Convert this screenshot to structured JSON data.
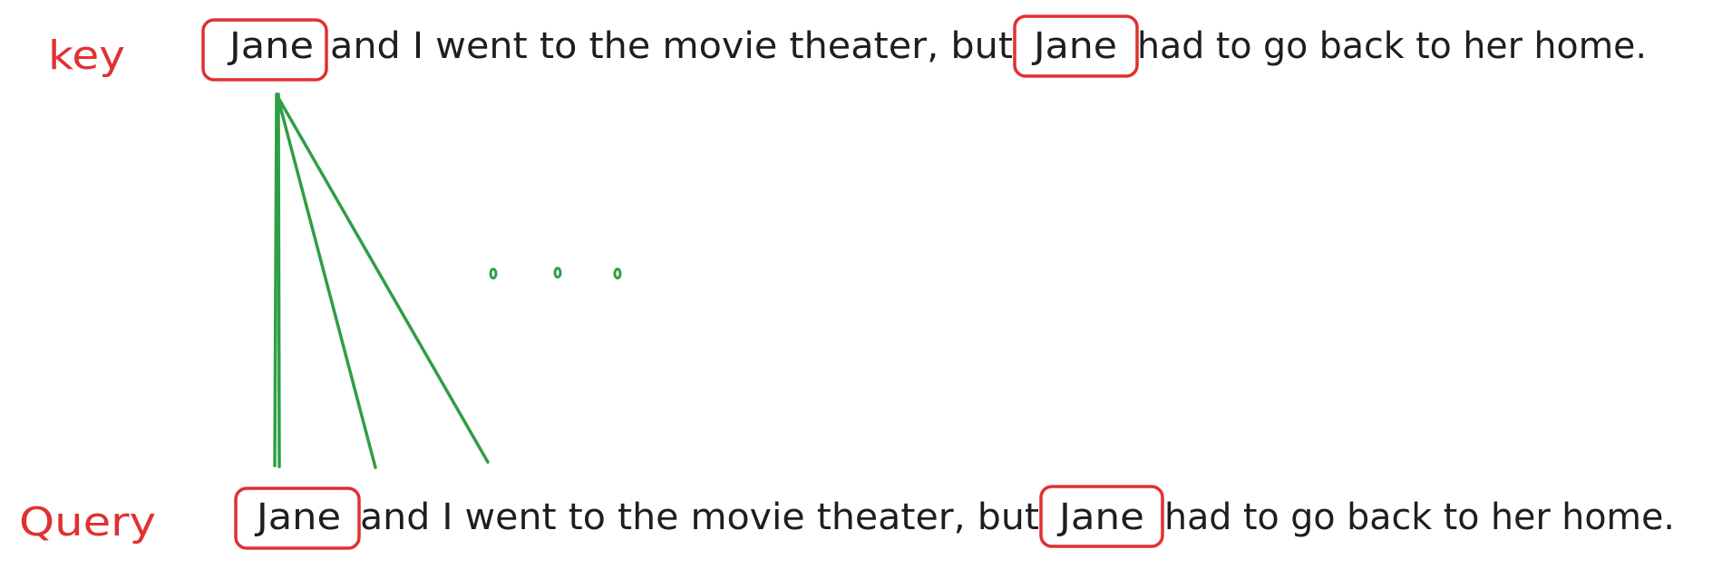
{
  "colors": {
    "label": "#e03131",
    "highlight_box": "#e03131",
    "attention_line": "#2f9e44",
    "text": "#1e1e1e"
  },
  "key_row": {
    "label": "key",
    "segments": [
      "Jane",
      "and I went to the movie theater, but",
      "Jane",
      "had to go back to her home."
    ]
  },
  "query_row": {
    "label": "Query",
    "segments": [
      "Jane",
      "and I went to the movie theater, but",
      "Jane",
      "had to go back to her home."
    ]
  },
  "ellipsis": "..."
}
